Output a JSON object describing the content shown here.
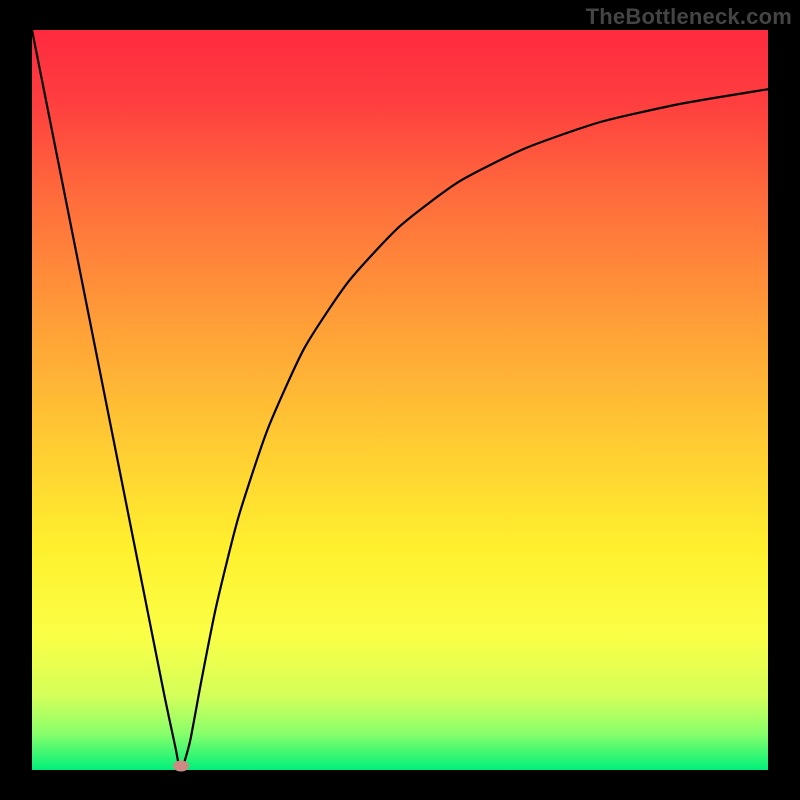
{
  "watermark": "TheBottleneck.com",
  "chart_data": {
    "type": "line",
    "title": "",
    "xlabel": "",
    "ylabel": "",
    "xlim": [
      0,
      100
    ],
    "ylim": [
      0,
      100
    ],
    "grid": false,
    "legend": false,
    "background": {
      "type": "vertical-gradient",
      "stops": [
        {
          "offset": 0.0,
          "color": "#ff2a3f"
        },
        {
          "offset": 0.1,
          "color": "#ff3f3f"
        },
        {
          "offset": 0.22,
          "color": "#ff6a3c"
        },
        {
          "offset": 0.38,
          "color": "#ff9a38"
        },
        {
          "offset": 0.55,
          "color": "#ffc933"
        },
        {
          "offset": 0.7,
          "color": "#fff02e"
        },
        {
          "offset": 0.82,
          "color": "#faff46"
        },
        {
          "offset": 0.9,
          "color": "#d4ff5a"
        },
        {
          "offset": 0.95,
          "color": "#8aff6a"
        },
        {
          "offset": 1.0,
          "color": "#00f07a"
        }
      ]
    },
    "series": [
      {
        "name": "bottleneck-curve",
        "color": "#000000",
        "stroke_width": 2.2,
        "data": [
          {
            "x": 0.0,
            "y": 100.0
          },
          {
            "x": 3.0,
            "y": 85.0
          },
          {
            "x": 6.0,
            "y": 70.0
          },
          {
            "x": 9.0,
            "y": 55.0
          },
          {
            "x": 12.0,
            "y": 40.0
          },
          {
            "x": 15.0,
            "y": 25.0
          },
          {
            "x": 18.0,
            "y": 10.0
          },
          {
            "x": 19.5,
            "y": 3.0
          },
          {
            "x": 20.0,
            "y": 0.5
          },
          {
            "x": 20.5,
            "y": 0.5
          },
          {
            "x": 21.5,
            "y": 4.0
          },
          {
            "x": 23.0,
            "y": 12.0
          },
          {
            "x": 25.0,
            "y": 22.0
          },
          {
            "x": 28.0,
            "y": 34.0
          },
          {
            "x": 32.0,
            "y": 46.0
          },
          {
            "x": 37.0,
            "y": 57.0
          },
          {
            "x": 43.0,
            "y": 66.0
          },
          {
            "x": 50.0,
            "y": 73.5
          },
          {
            "x": 58.0,
            "y": 79.5
          },
          {
            "x": 67.0,
            "y": 84.0
          },
          {
            "x": 77.0,
            "y": 87.5
          },
          {
            "x": 88.0,
            "y": 90.0
          },
          {
            "x": 100.0,
            "y": 92.0
          }
        ]
      }
    ],
    "marker": {
      "name": "optimal-point",
      "x": 20.3,
      "y": 0.5,
      "color": "#cf8a86",
      "shape": "ellipse"
    }
  }
}
